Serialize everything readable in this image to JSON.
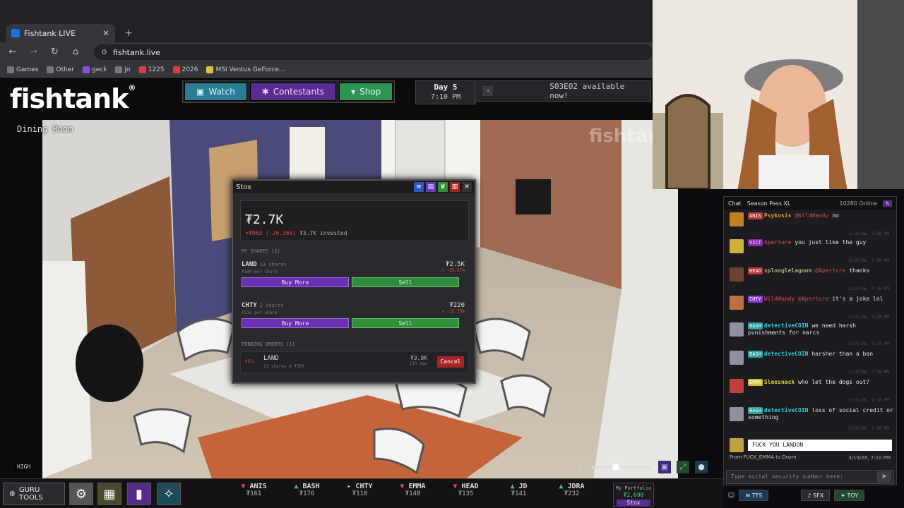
{
  "browser": {
    "tab_title": "Fishtank LIVE",
    "url": "fishtank.live",
    "bookmarks": [
      {
        "label": "Games",
        "color": "#777"
      },
      {
        "label": "Other",
        "color": "#777"
      },
      {
        "label": "geck",
        "color": "#8a4fd8"
      },
      {
        "label": "Jo",
        "color": "#777"
      },
      {
        "label": "1225",
        "color": "#e03c3c"
      },
      {
        "label": "2026",
        "color": "#e03c3c"
      },
      {
        "label": "MSI Ventus GeForce...",
        "color": "#e0c03c"
      }
    ]
  },
  "header": {
    "logo": "fishtank",
    "logo_mark": "®",
    "nav": {
      "watch": "Watch",
      "contestants": "Contestants",
      "shop": "Shop"
    },
    "day": "Day 5",
    "time": "7:10 PM",
    "announcement": "S03E02 available now!"
  },
  "camera": {
    "room": "Dining Room",
    "watermark": "fishtank",
    "quality": "HIGH",
    "volume_fraction": 0.4
  },
  "stox": {
    "title": "Stox",
    "total_value": "₮2.7K",
    "change": "▾₮963 (-26.36%)",
    "invested": "₮3.7K invested",
    "my_shares_label": "MY SHARES (2)",
    "positions": [
      {
        "name": "LAND",
        "shares": "13 shares",
        "per": "₮190 per share",
        "value": "₮2.5K",
        "change": "▾ -25.67%",
        "buy": "Buy More",
        "sell": "Sell"
      },
      {
        "name": "CHTY",
        "shares": "2 shares",
        "per": "₮110 per share",
        "value": "₮220",
        "change": "▾ -33.33%",
        "buy": "Buy More",
        "sell": "Sell"
      }
    ],
    "pending_label": "PENDING ORDERS (1)",
    "pending": {
      "side": "SELL",
      "name": "LAND",
      "detail": "13 shares @ ₮300",
      "value": "₮3.9K",
      "age": "11h ago",
      "cancel": "Cancel"
    }
  },
  "bottom": {
    "guru_tools": "GURU TOOLS",
    "tickers": [
      {
        "sym": "ANIS",
        "price": "₮161",
        "dir": "down"
      },
      {
        "sym": "BASH",
        "price": "₮176",
        "dir": "up"
      },
      {
        "sym": "CHTY",
        "price": "₮110",
        "dir": "flat"
      },
      {
        "sym": "EMMA",
        "price": "₮140",
        "dir": "down"
      },
      {
        "sym": "HEAD",
        "price": "₮135",
        "dir": "down"
      },
      {
        "sym": "JD",
        "price": "₮141",
        "dir": "up"
      },
      {
        "sym": "JDRA",
        "price": "₮232",
        "dir": "up"
      }
    ],
    "portfolio_label": "My Portfolio",
    "portfolio_value": "₮2,690",
    "portfolio_btn": "Stox"
  },
  "chat": {
    "tab_chat": "Chat",
    "tab_season": "Season Pass XL",
    "online": "10280 Online",
    "messages": [
      {
        "tag": "ANIS",
        "tag_color": "#b23a3a",
        "user": "Psykosis",
        "user_color": "#d0a030",
        "mention": "@WildWandy",
        "text": "no",
        "ts": "3/19/26, 7:10 PM",
        "avatar": "#c08020"
      },
      {
        "tag": "VICT",
        "tag_color": "#8a2ab0",
        "user": "Aperture",
        "user_color": "#b03a3a",
        "mention": "",
        "text": "you just like the guy",
        "ts": "3/19/26, 7:10 PM",
        "avatar": "#d0b040"
      },
      {
        "tag": "HEAD",
        "tag_color": "#b23a3a",
        "user": "splooglelagoon",
        "user_color": "#b0b080",
        "mention": "@Aperture",
        "text": "thanks",
        "ts": "3/19/26, 7:10 PM",
        "avatar": "#704030"
      },
      {
        "tag": "CHTY",
        "tag_color": "#8a3ad0",
        "user": "WildWandy",
        "user_color": "#b03a3a",
        "mention": "@Aperture",
        "text": "it's a joke lol",
        "ts": "3/19/26, 7:10 PM",
        "avatar": "#c07040"
      },
      {
        "tag": "BASH",
        "tag_color": "#2aa0a0",
        "user": "detectiveCOIN",
        "user_color": "#30d0e0",
        "mention": "",
        "text": "we need harsh punishments for narcs",
        "ts": "3/19/26, 7:10 PM",
        "avatar": "#9090a0"
      },
      {
        "tag": "BASH",
        "tag_color": "#2aa0a0",
        "user": "detectiveCOIN",
        "user_color": "#30d0e0",
        "mention": "",
        "text": "harsher than a ban",
        "ts": "3/19/26, 7:10 PM",
        "avatar": "#9090a0"
      },
      {
        "tag": "EMMA",
        "tag_color": "#d0c030",
        "user": "Sleesnack",
        "user_color": "#e0d040",
        "mention": "",
        "text": "who let the dogs out?",
        "ts": "3/19/26, 7:10 PM",
        "avatar": "#c04040"
      },
      {
        "tag": "BASH",
        "tag_color": "#2aa0a0",
        "user": "detectiveCOIN",
        "user_color": "#30d0e0",
        "mention": "",
        "text": "loss of social credit or something",
        "ts": "3/19/26, 7:10 PM",
        "avatar": "#9090a0"
      }
    ],
    "tts_text": "FUCK YOU LANDON",
    "tts_from": "From FUCK_EMMA to Dozm",
    "tts_ts": "3/19/26, 7:10 PM",
    "input_placeholder": "Type social security number here:",
    "btn_tts": "TTS",
    "btn_sfx": "SFX",
    "btn_toy": "TOY"
  }
}
